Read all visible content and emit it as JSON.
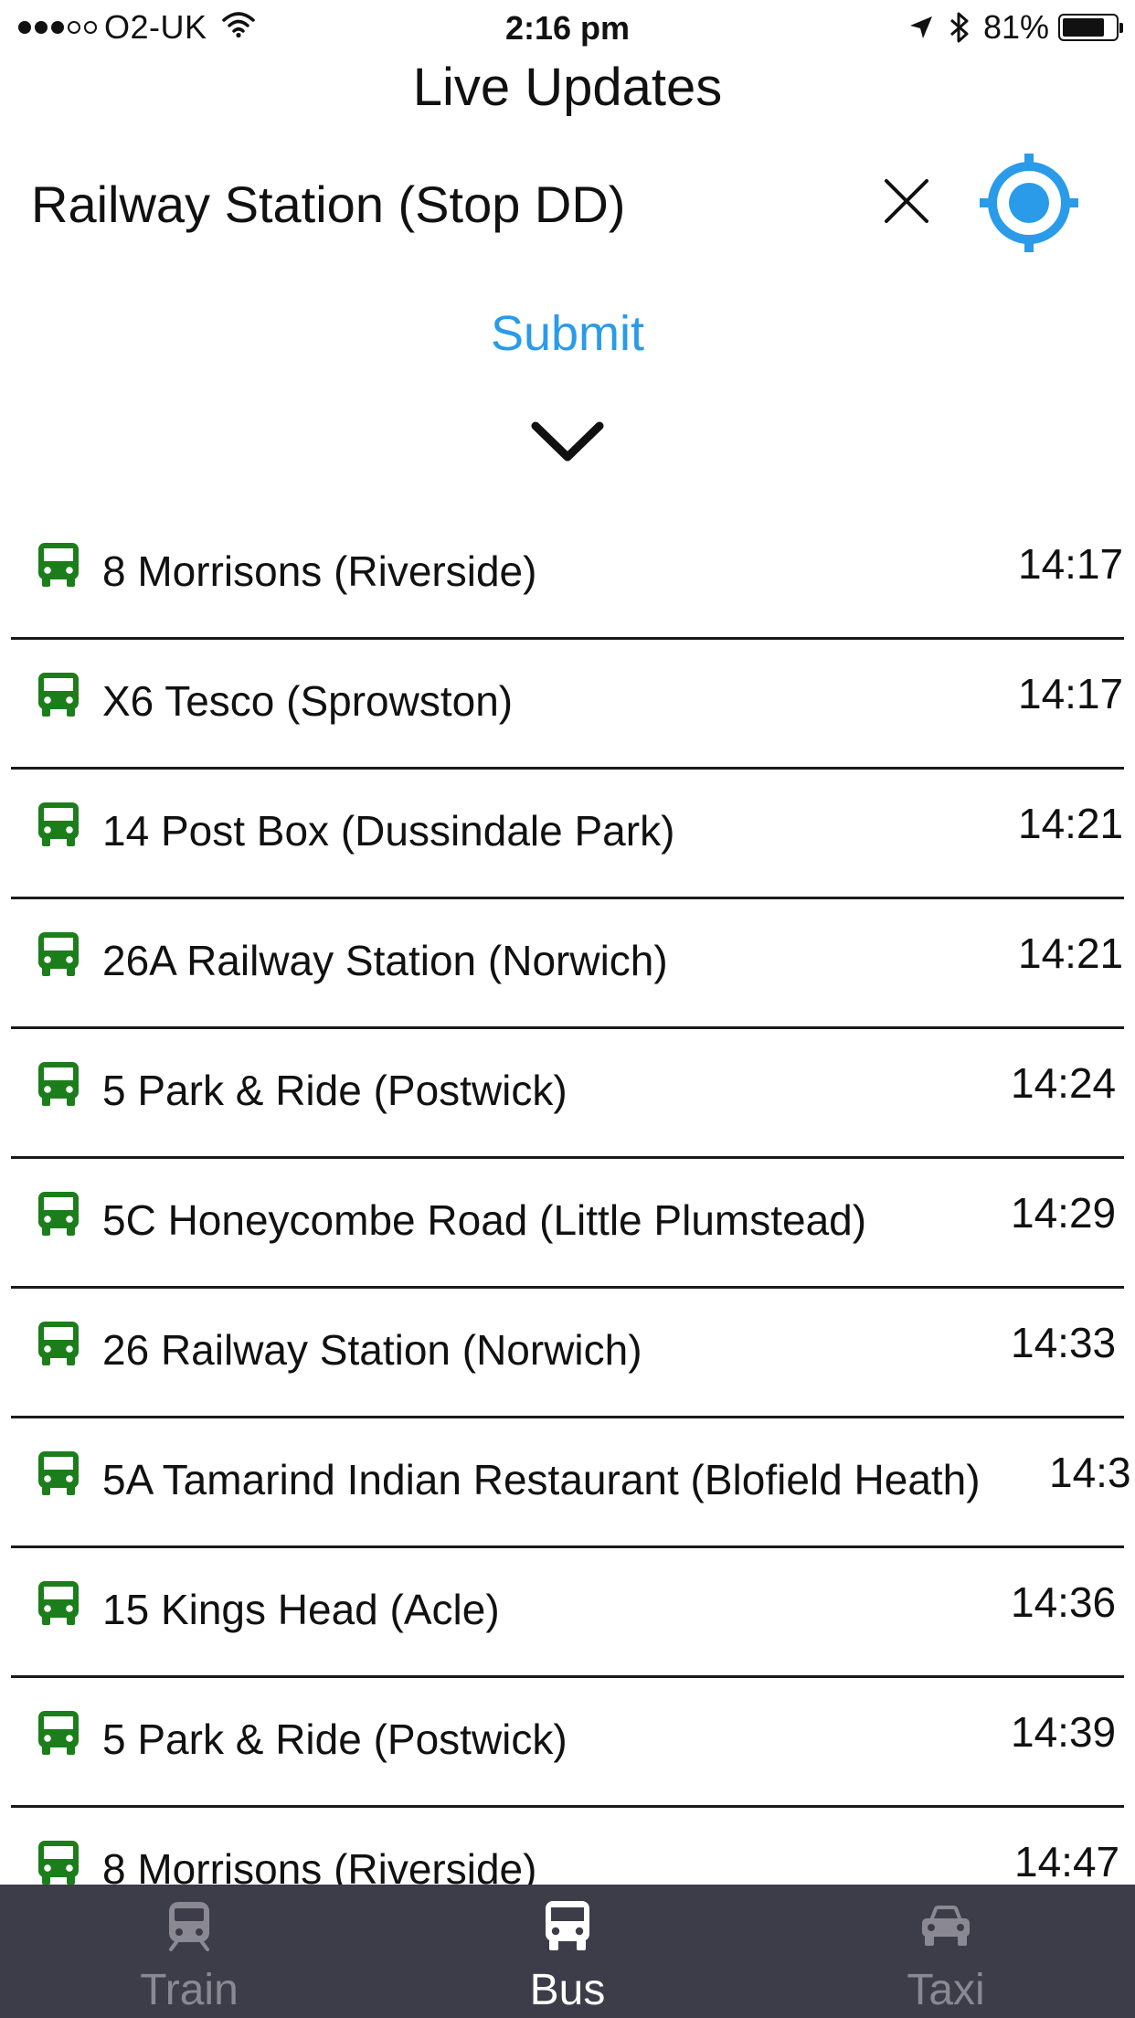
{
  "status_bar": {
    "carrier": "O2-UK",
    "time": "2:16 pm",
    "battery": "81%",
    "battery_level": 0.81,
    "signal_bars_filled": 3,
    "signal_bars_total": 5,
    "icons": [
      "signal-dots",
      "wifi-icon",
      "location-arrow-icon",
      "bluetooth-icon",
      "battery-icon"
    ]
  },
  "header": {
    "title": "Live Updates"
  },
  "search": {
    "value": "Railway Station (Stop DD)",
    "clear_icon": "close-icon",
    "locate_icon": "crosshair-icon"
  },
  "submit_label": "Submit",
  "expand_icon": "chevron-down-icon",
  "departures": [
    {
      "route": "8 Morrisons (Riverside)",
      "time": "14:17"
    },
    {
      "route": "X6 Tesco (Sprowston)",
      "time": "14:17"
    },
    {
      "route": "14 Post Box (Dussindale Park)",
      "time": "14:21"
    },
    {
      "route": "26A Railway Station (Norwich)",
      "time": "14:21"
    },
    {
      "route": "5 Park & Ride (Postwick)",
      "time": "14:24"
    },
    {
      "route": "5C Honeycombe Road (Little Plumstead)",
      "time": "14:29"
    },
    {
      "route": "26 Railway Station (Norwich)",
      "time": "14:33"
    },
    {
      "route": "5A Tamarind Indian Restaurant (Blofield Heath)",
      "time": "14:3"
    },
    {
      "route": "15 Kings Head (Acle)",
      "time": "14:36"
    },
    {
      "route": "5 Park & Ride (Postwick)",
      "time": "14:39"
    },
    {
      "route": "8 Morrisons (Riverside)",
      "time": "14:47"
    }
  ],
  "tabs": [
    {
      "label": "Train",
      "icon": "train-icon",
      "active": false
    },
    {
      "label": "Bus",
      "icon": "bus-icon",
      "active": true
    },
    {
      "label": "Taxi",
      "icon": "taxi-icon",
      "active": false
    }
  ],
  "colors": {
    "accent": "#2a9be8",
    "bus_icon": "#1b7e1b",
    "tab_bar": "#3d3c49",
    "tab_inactive": "#8a8993",
    "tab_active": "#ffffff"
  }
}
